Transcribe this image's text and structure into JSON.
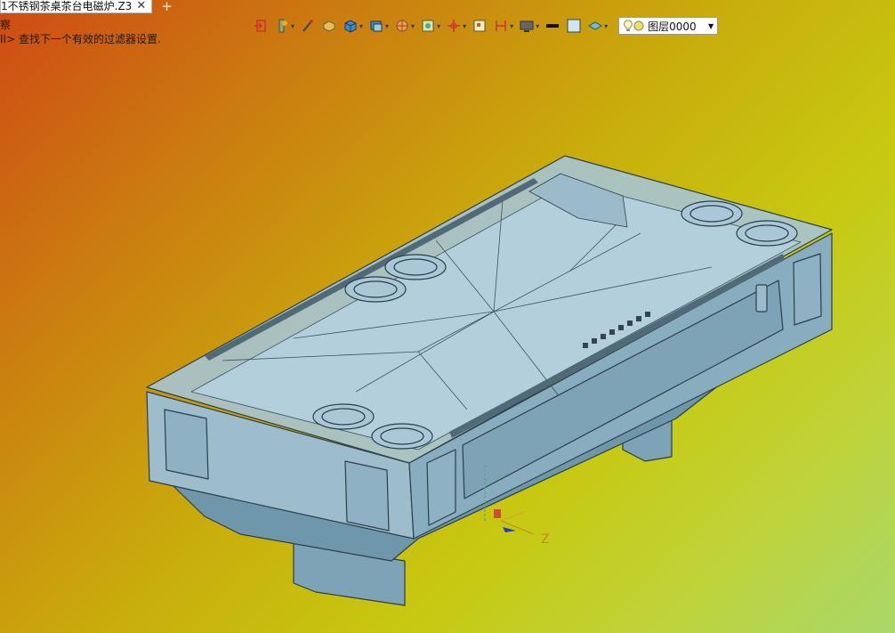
{
  "document_tab": {
    "title": "1不锈钢茶桌茶台电磁炉.Z3",
    "close_glyph": "✕"
  },
  "new_tab_glyph": "+",
  "command_line": {
    "line1": "察",
    "line2": "II> 查找下一个有效的过滤器设置."
  },
  "toolbar": {
    "icons": [
      "exit-icon",
      "pipe-icon",
      "brush-icon",
      "block-icon",
      "cube-icon",
      "shaded-view-icon",
      "wireframe-icon",
      "filter-icon",
      "snap-icon",
      "grid-icon",
      "align-icon",
      "display-icon",
      "line-color-icon",
      "fill-icon",
      "layer-view-icon"
    ]
  },
  "layer_selector": {
    "value": "图层0000"
  },
  "triad": {
    "z_label": "Z"
  },
  "colors": {
    "accent_body": "#8fb3c6",
    "axis_z": "#c58a24",
    "background_top": "#cf4a14",
    "background_bottom": "#a8d86a"
  }
}
